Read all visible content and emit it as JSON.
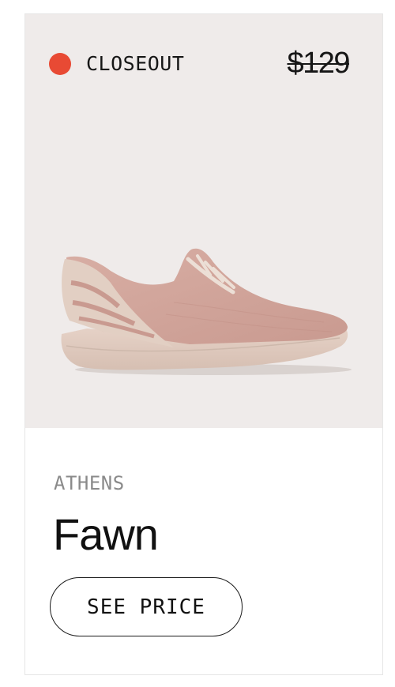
{
  "badge": {
    "label": "CLOSEOUT",
    "dot_color": "#e84a34"
  },
  "price": {
    "original": "$129"
  },
  "product": {
    "image_icon": "sneaker-image",
    "collection": "ATHENS",
    "name": "Fawn",
    "cta_label": "SEE PRICE"
  }
}
